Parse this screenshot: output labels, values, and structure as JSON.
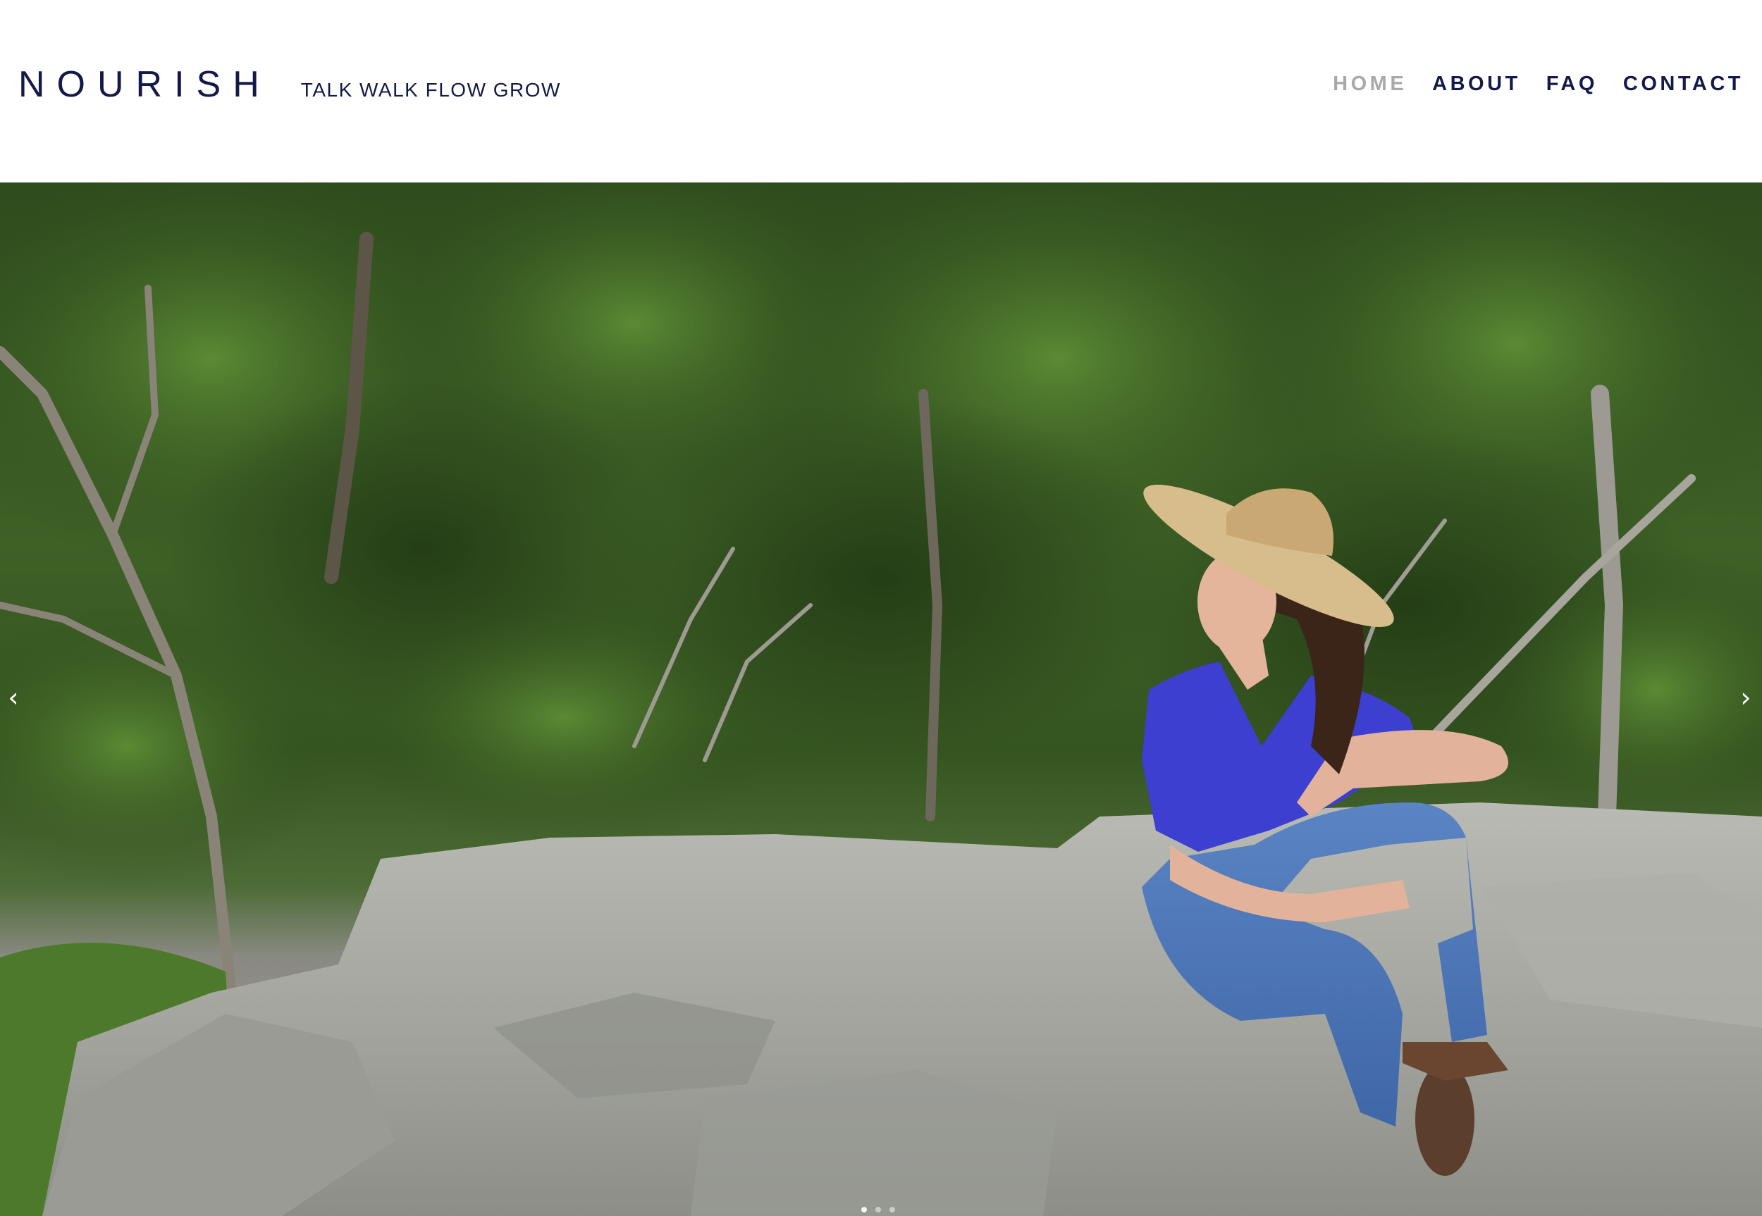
{
  "site": {
    "logo": "NOURISH",
    "tagline": "TALK WALK FLOW GROW"
  },
  "nav": {
    "items": [
      {
        "label": "HOME",
        "active": true
      },
      {
        "label": "ABOUT",
        "active": false
      },
      {
        "label": "FAQ",
        "active": false
      },
      {
        "label": "CONTACT",
        "active": false
      }
    ]
  },
  "hero": {
    "prev_icon": "chevron-left-icon",
    "next_icon": "chevron-right-icon",
    "prev_glyph": "‹",
    "next_glyph": "›"
  },
  "colors": {
    "brand_navy": "#131a49",
    "nav_active": "#a9a9ab",
    "background": "#ffffff"
  }
}
